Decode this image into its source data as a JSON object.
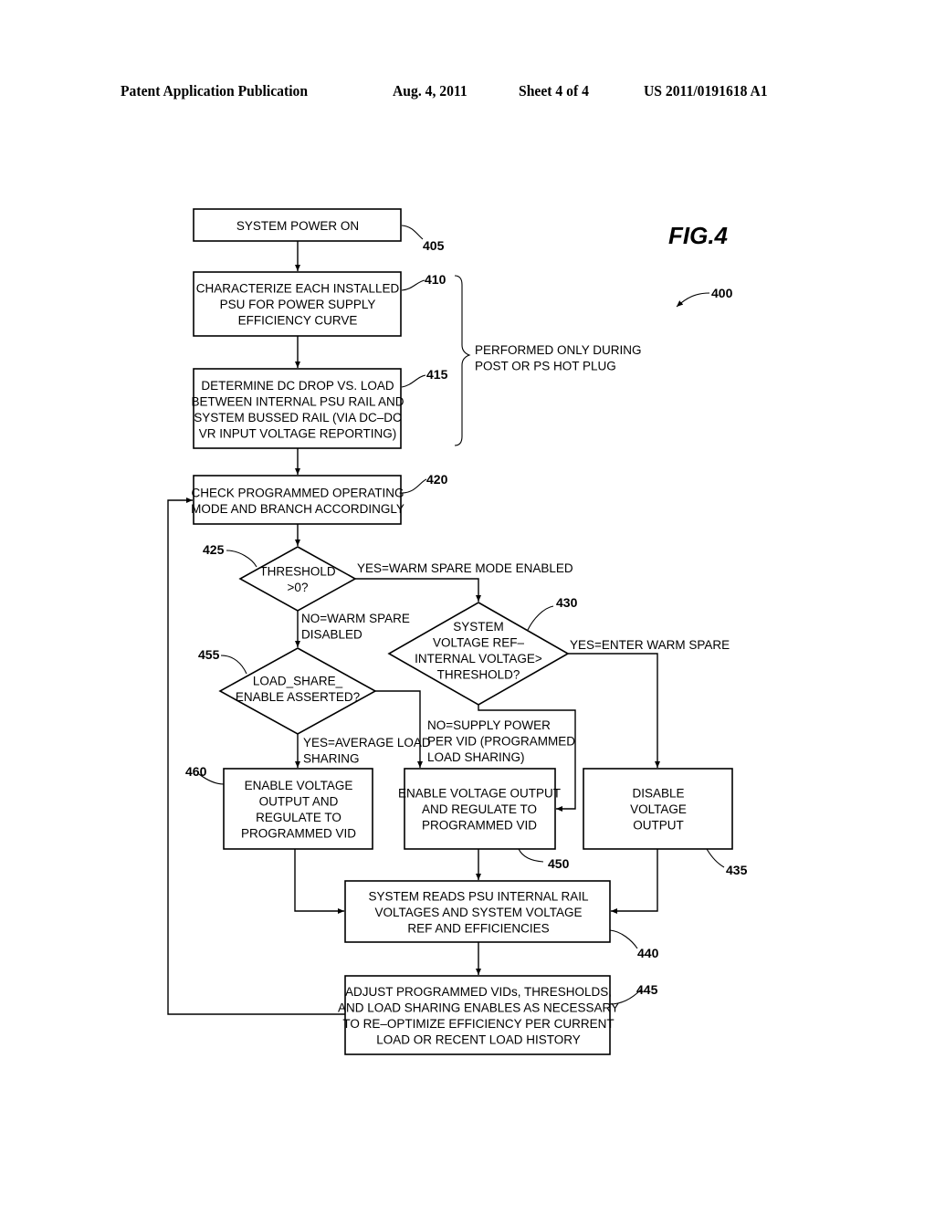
{
  "header": {
    "publication": "Patent Application Publication",
    "date": "Aug. 4, 2011",
    "sheet": "Sheet 4 of 4",
    "number": "US 2011/0191618 A1"
  },
  "figure": {
    "label": "FIG.4",
    "ref": "400"
  },
  "nodes": {
    "n405": {
      "ref": "405",
      "lines": [
        "SYSTEM  POWER  ON"
      ]
    },
    "n410": {
      "ref": "410",
      "lines": [
        "CHARACTERIZE  EACH  INSTALLED",
        "PSU  FOR  POWER  SUPPLY",
        "EFFICIENCY  CURVE"
      ]
    },
    "n415": {
      "ref": "415",
      "lines": [
        "DETERMINE  DC  DROP  VS.  LOAD",
        "BETWEEN  INTERNAL  PSU  RAIL  AND",
        "SYSTEM  BUSSED  RAIL  (VIA  DC–DC",
        "VR  INPUT  VOLTAGE  REPORTING)"
      ]
    },
    "n420": {
      "ref": "420",
      "lines": [
        "CHECK  PROGRAMMED  OPERATING",
        "MODE  AND  BRANCH  ACCORDINGLY"
      ]
    },
    "n425": {
      "ref": "425",
      "lines": [
        "THRESHOLD",
        ">0?"
      ]
    },
    "n430": {
      "ref": "430",
      "lines": [
        "SYSTEM",
        "VOLTAGE  REF–",
        "INTERNAL  VOLTAGE>",
        "THRESHOLD?"
      ]
    },
    "n435": {
      "ref": "435",
      "lines": [
        "DISABLE",
        "VOLTAGE",
        "OUTPUT"
      ]
    },
    "n440": {
      "ref": "440",
      "lines": [
        "SYSTEM  READS  PSU  INTERNAL  RAIL",
        "VOLTAGES  AND  SYSTEM  VOLTAGE",
        "REF  AND  EFFICIENCIES"
      ]
    },
    "n445": {
      "ref": "445",
      "lines": [
        "ADJUST  PROGRAMMED  VIDs,  THRESHOLDS,",
        "AND  LOAD  SHARING  ENABLES  AS  NECESSARY",
        "TO  RE–OPTIMIZE  EFFICIENCY  PER  CURRENT",
        "LOAD  OR  RECENT  LOAD  HISTORY"
      ]
    },
    "n450": {
      "ref": "450",
      "lines": [
        "ENABLE  VOLTAGE  OUTPUT",
        "AND  REGULATE  TO",
        "PROGRAMMED  VID"
      ]
    },
    "n455": {
      "ref": "455",
      "lines": [
        "LOAD_SHARE_",
        "ENABLE  ASSERTED?"
      ]
    },
    "n460": {
      "ref": "460",
      "lines": [
        "ENABLE  VOLTAGE",
        "OUTPUT  AND",
        "REGULATE  TO",
        "PROGRAMMED  VID"
      ]
    }
  },
  "edge_labels": {
    "yes_425": [
      "YES=WARM  SPARE  MODE  ENABLED"
    ],
    "no_425": [
      "NO=WARM  SPARE",
      "DISABLED"
    ],
    "yes_430": [
      "YES=ENTER  WARM  SPARE"
    ],
    "no_430": [
      "NO=SUPPLY  POWER",
      "PER  VID  (PROGRAMMED",
      "LOAD  SHARING)"
    ],
    "yes_455": [
      "YES=AVERAGE  LOAD",
      "SHARING"
    ]
  },
  "brace_note": [
    "PERFORMED  ONLY  DURING",
    "POST  OR  PS  HOT  PLUG"
  ]
}
